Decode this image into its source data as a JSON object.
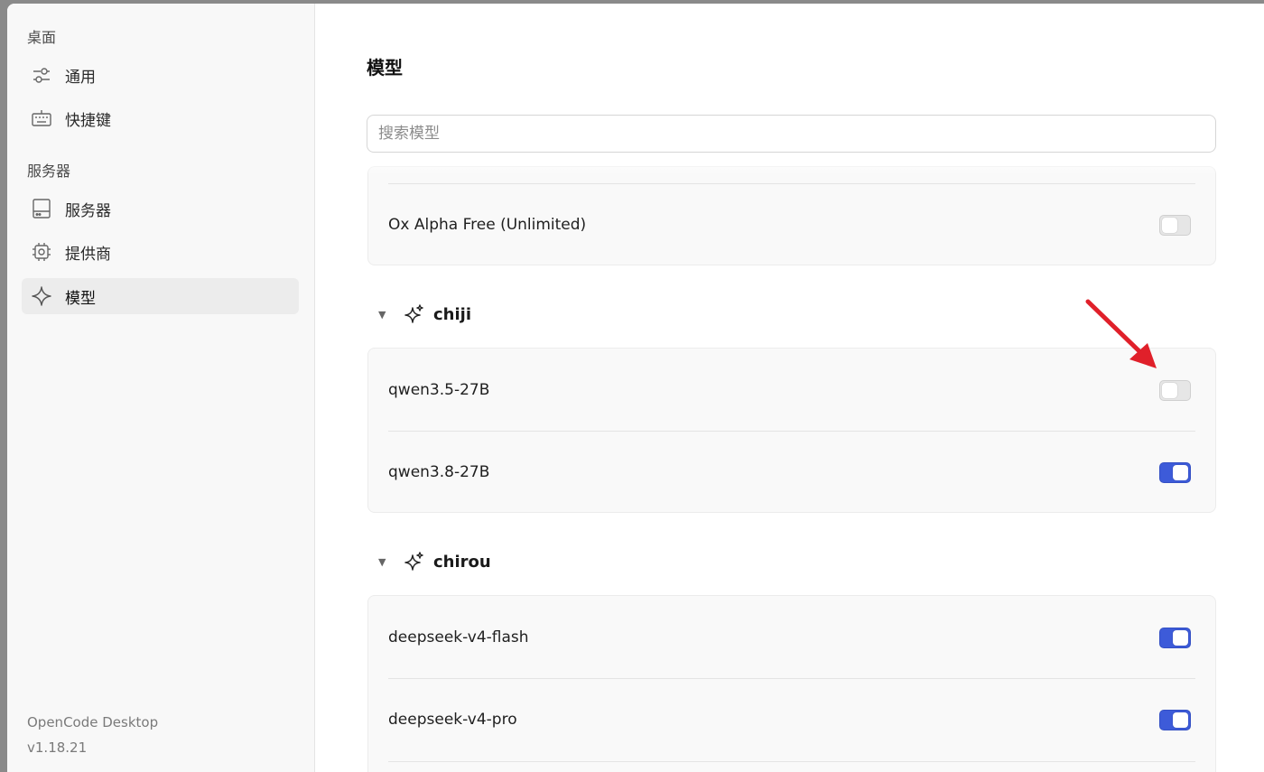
{
  "sidebar": {
    "section_desktop": "桌面",
    "items_desktop": [
      {
        "label": "通用",
        "icon": "sliders-icon"
      },
      {
        "label": "快捷键",
        "icon": "keyboard-icon"
      }
    ],
    "section_server": "服务器",
    "items_server": [
      {
        "label": "服务器",
        "icon": "server-icon"
      },
      {
        "label": "提供商",
        "icon": "chip-icon"
      },
      {
        "label": "模型",
        "icon": "sparkle-icon",
        "active": true
      }
    ],
    "footer": {
      "app_name": "OpenCode Desktop",
      "version": "v1.18.21"
    }
  },
  "main": {
    "title": "模型",
    "search": {
      "placeholder": "搜索模型",
      "value": ""
    },
    "top_card": {
      "models": [
        {
          "name": "Ox Alpha Free (Unlimited)",
          "enabled": false
        }
      ]
    },
    "groups": [
      {
        "name": "chiji",
        "expanded": true,
        "models": [
          {
            "name": "qwen3.5-27B",
            "enabled": false
          },
          {
            "name": "qwen3.8-27B",
            "enabled": true
          }
        ]
      },
      {
        "name": "chirou",
        "expanded": true,
        "models": [
          {
            "name": "deepseek-v4-flash",
            "enabled": true
          },
          {
            "name": "deepseek-v4-pro",
            "enabled": true
          }
        ]
      }
    ]
  },
  "colors": {
    "toggle_on": "#3d5bd9",
    "toggle_off": "#e6e6e6",
    "annotation_arrow": "#e0202a",
    "sidebar_bg": "#f8f8f8",
    "active_item_bg": "#ececec"
  }
}
